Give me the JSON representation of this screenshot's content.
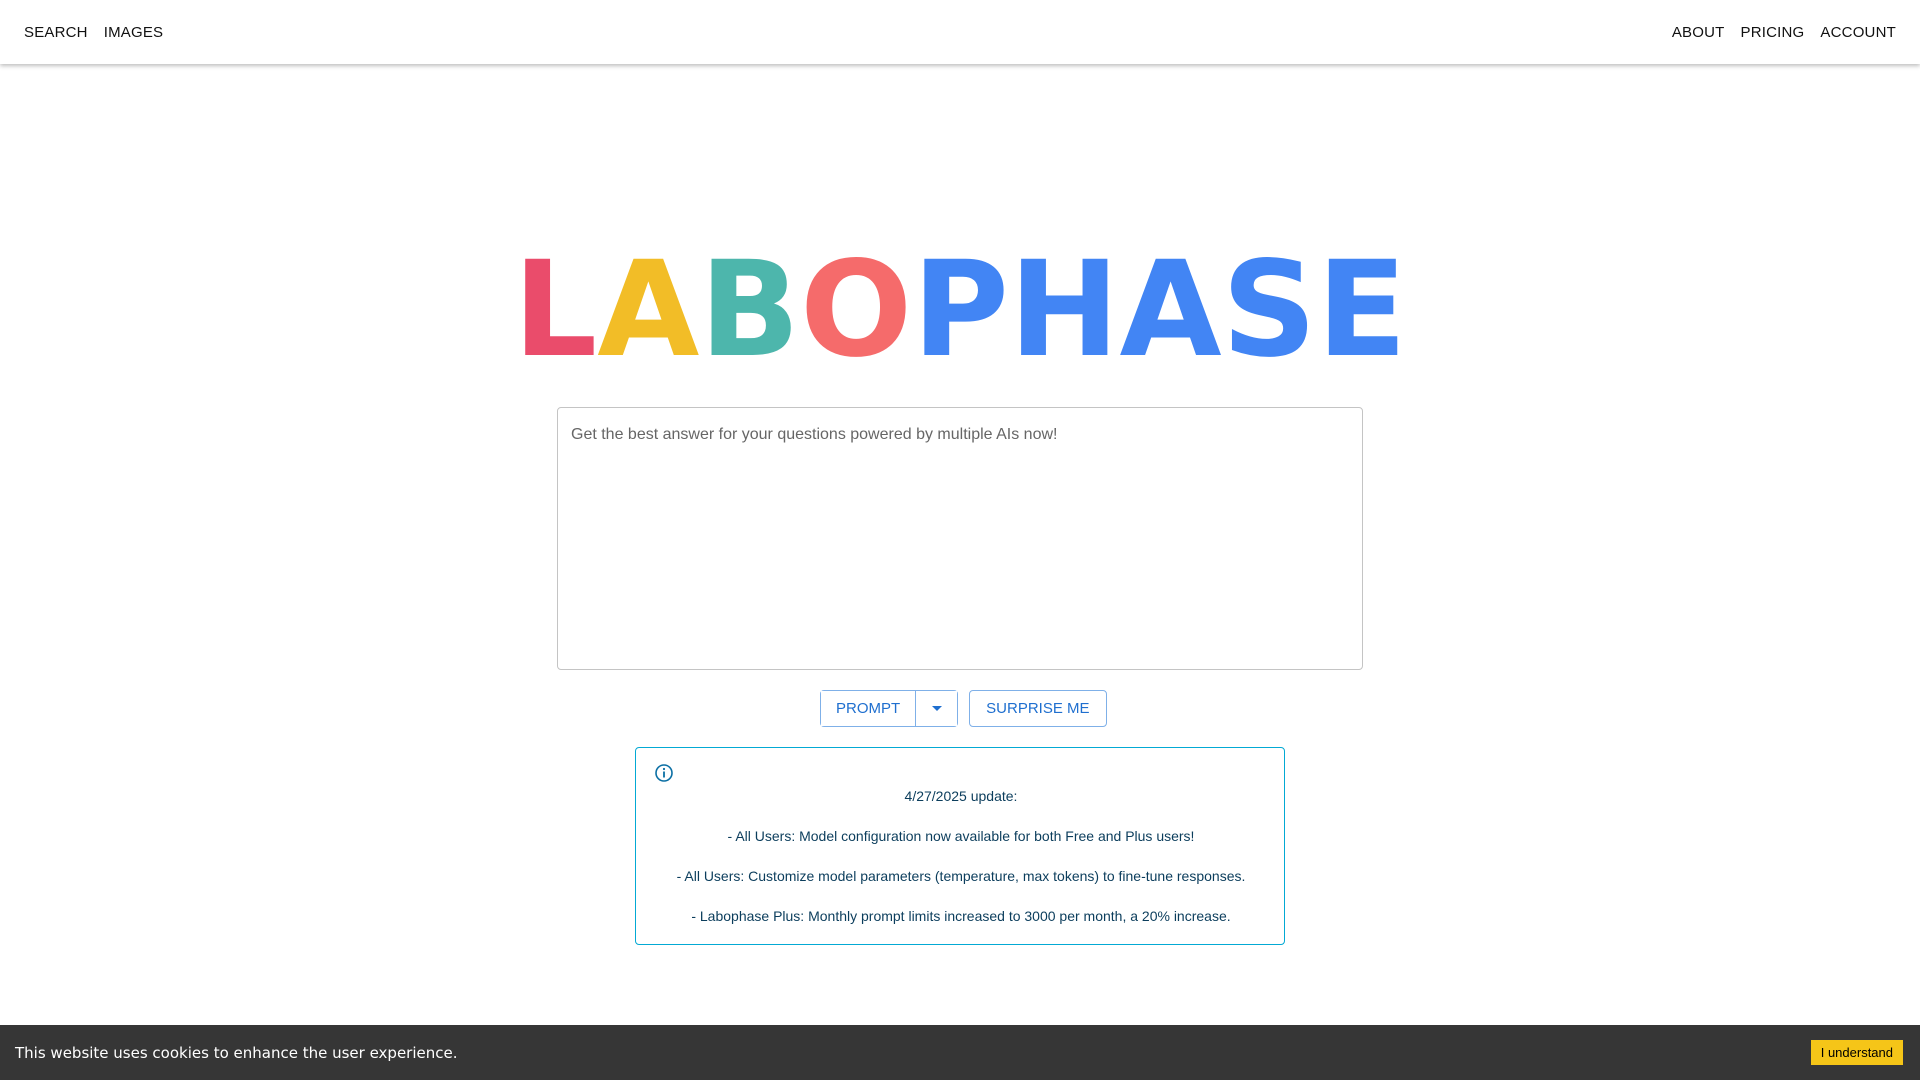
{
  "nav": {
    "left": [
      {
        "label": "SEARCH"
      },
      {
        "label": "IMAGES"
      }
    ],
    "right": [
      {
        "label": "ABOUT"
      },
      {
        "label": "PRICING"
      },
      {
        "label": "ACCOUNT"
      }
    ]
  },
  "logo": {
    "letters": [
      {
        "char": "L",
        "color": "#ea4c6b"
      },
      {
        "char": "A",
        "color": "#f2bd27"
      },
      {
        "char": "B",
        "color": "#4db6ac"
      },
      {
        "char": "O",
        "color": "#f56b6b"
      },
      {
        "char": "P",
        "color": "#4285f4"
      },
      {
        "char": "H",
        "color": "#4285f4"
      },
      {
        "char": "A",
        "color": "#4285f4"
      },
      {
        "char": "S",
        "color": "#4285f4"
      },
      {
        "char": "E",
        "color": "#4285f4"
      }
    ]
  },
  "prompt": {
    "placeholder": "Get the best answer for your questions powered by multiple AIs now!",
    "value": ""
  },
  "actions": {
    "prompt_label": "PROMPT",
    "dropdown_icon": "caret-down-icon",
    "surprise_label": "SURPRISE ME"
  },
  "alert": {
    "icon": "info-icon",
    "lines": [
      "4/27/2025 update:",
      "- All Users: Model configuration now available for both Free and Plus users!",
      "- All Users: Customize model parameters (temperature, max tokens) to fine-tune responses.",
      "- Labophase Plus: Monthly prompt limits increased to 3000 per month, a 20% increase."
    ]
  },
  "cookie": {
    "text": "This website uses cookies to enhance the user experience.",
    "button_label": "I understand"
  },
  "colors": {
    "accent": "#1f6fcf",
    "alert_border": "#03a9d4",
    "cookie_bg": "#363636",
    "cookie_button": "#f5c518"
  }
}
